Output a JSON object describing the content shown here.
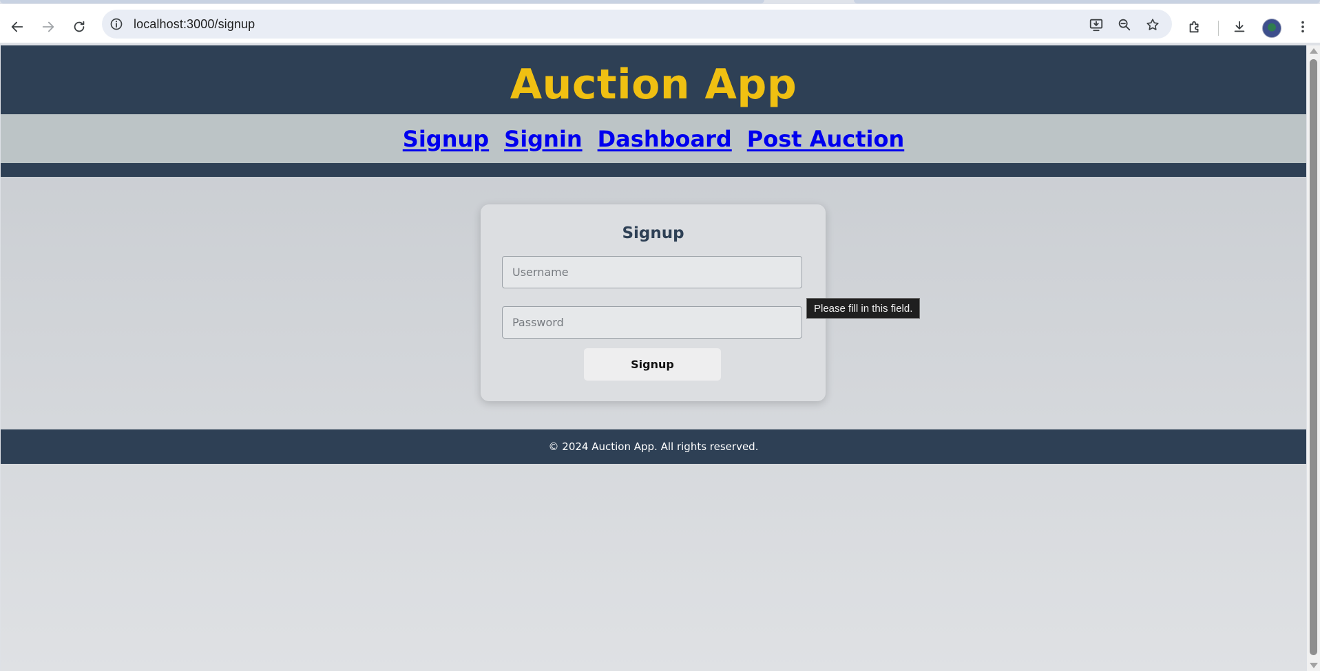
{
  "browser": {
    "url": "localhost:3000/signup",
    "icons": {
      "back": "arrow-left-icon",
      "forward": "arrow-right-icon",
      "reload": "reload-icon",
      "site_info": "info-icon",
      "install": "install-app-icon",
      "zoom": "zoom-out-icon",
      "bookmark": "star-icon",
      "extensions": "puzzle-icon",
      "downloads": "download-icon",
      "profile": "avatar",
      "menu": "kebab-menu-icon"
    }
  },
  "header": {
    "title": "Auction App"
  },
  "nav": {
    "links": [
      {
        "label": "Signup"
      },
      {
        "label": "Signin"
      },
      {
        "label": "Dashboard"
      },
      {
        "label": "Post Auction"
      }
    ]
  },
  "form": {
    "heading": "Signup",
    "username_placeholder": "Username",
    "username_value": "",
    "password_placeholder": "Password",
    "password_value": "",
    "submit_label": "Signup",
    "validation_tooltip": "Please fill in this field."
  },
  "footer": {
    "text": "© 2024 Auction App. All rights reserved."
  },
  "colors": {
    "header_bg": "#2e4055",
    "title": "#f0c012",
    "nav_bg": "#bcc4c6",
    "link": "#0000ee"
  }
}
